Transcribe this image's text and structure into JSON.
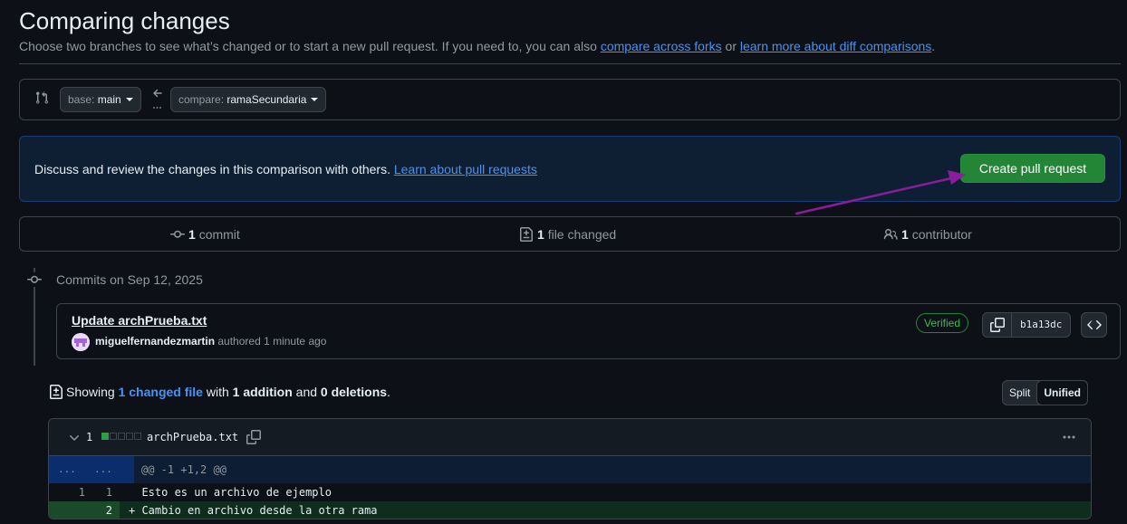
{
  "header": {
    "title": "Comparing changes",
    "subtitle_prefix": "Choose two branches to see what’s changed or to start a new pull request. If you need to, you can also ",
    "link_forks": "compare across forks",
    "subtitle_mid": " or ",
    "link_learn": "learn more about diff comparisons",
    "subtitle_suffix": "."
  },
  "range": {
    "base_label": "base:",
    "base_value": "main",
    "compare_label": "compare:",
    "compare_value": "ramaSecundaria"
  },
  "pr": {
    "text": "Discuss and review the changes in this comparison with others.",
    "link": "Learn about pull requests",
    "button": "Create pull request"
  },
  "stats": {
    "commits_count": "1",
    "commits_label": "commit",
    "files_count": "1",
    "files_label": "file changed",
    "contributors_count": "1",
    "contributors_label": "contributor"
  },
  "commits": {
    "date_heading": "Commits on Sep 12, 2025",
    "items": [
      {
        "title": "Update archPrueba.txt",
        "author": "miguelfernandezmartin",
        "meta": "authored 1 minute ago",
        "verified": "Verified",
        "sha": "b1a13dc"
      }
    ]
  },
  "summary": {
    "prefix": "Showing",
    "changed_link": "1 changed file",
    "with": "with",
    "additions": "1 addition",
    "and": "and",
    "deletions": "0 deletions",
    "end": "."
  },
  "view_toggle": {
    "split": "Split",
    "unified": "Unified"
  },
  "file": {
    "count": "1",
    "name": "archPrueba.txt",
    "diffstat": {
      "additions": 1,
      "blocks": 5
    },
    "hunk": {
      "left": "...",
      "right": "...",
      "header": "@@ -1 +1,2 @@"
    },
    "lines": [
      {
        "old": "1",
        "new": "1",
        "text": "  Esto es un archivo de ejemplo"
      },
      {
        "old": "",
        "new": "2",
        "text": "+ Cambio en archivo desde la otra rama"
      }
    ]
  },
  "colors": {
    "accent": "#4493f8",
    "primary_button": "#238636",
    "annotation_arrow": "#8a1c9e"
  }
}
